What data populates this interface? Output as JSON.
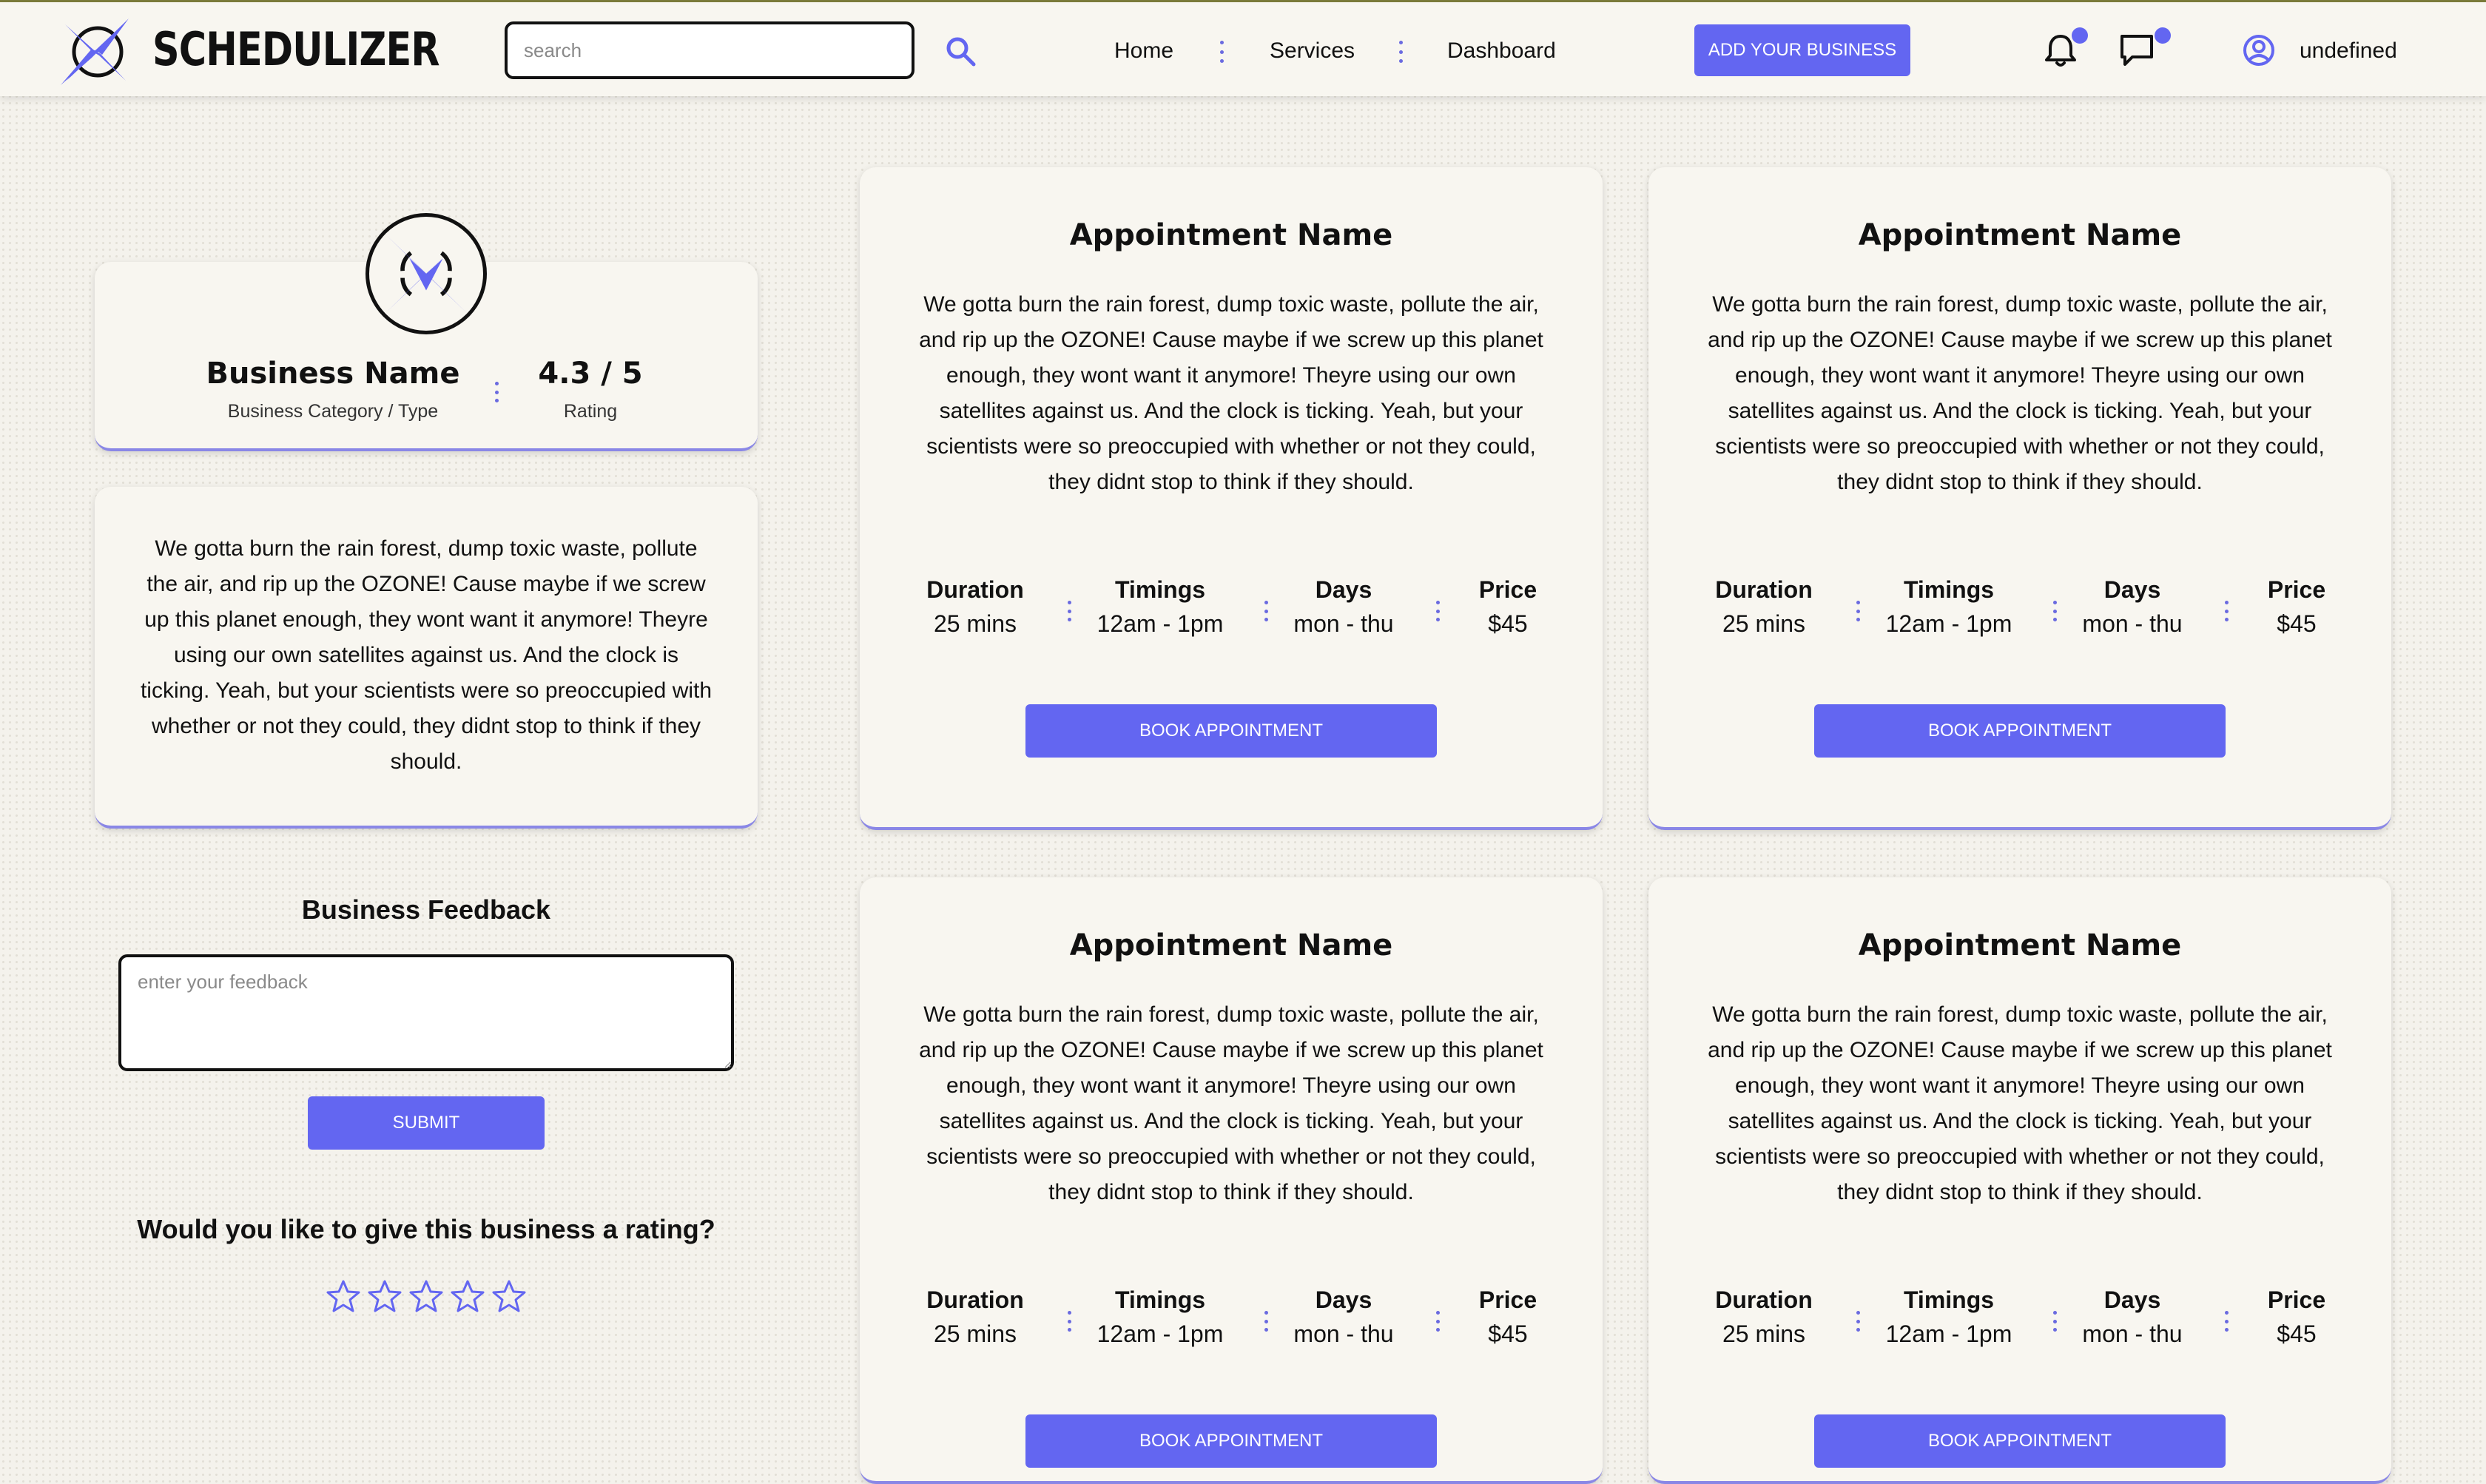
{
  "navbar": {
    "brand": "SCHEDULIZER",
    "search_placeholder": "search",
    "links": [
      "Home",
      "Services",
      "Dashboard"
    ],
    "add_business_label": "ADD YOUR BUSINESS",
    "username": "undefined",
    "notification_dot": true,
    "message_dot": true
  },
  "business": {
    "name": "Business Name",
    "category": "Business Category / Type",
    "rating": "4.3 / 5",
    "rating_label": "Rating",
    "description": "We gotta burn the rain forest, dump toxic waste, pollute the air, and rip up the OZONE! Cause maybe if we screw up this planet enough, they wont want it anymore! Theyre using our own satellites against us. And the clock is ticking. Yeah, but your scientists were so preoccupied with whether or not they could, they didnt stop to think if they should."
  },
  "feedback": {
    "title": "Business Feedback",
    "placeholder": "enter your feedback",
    "submit_label": "SUBMIT",
    "rating_question": "Would you like to give this business a rating?",
    "stars_selected": 0,
    "stars_total": 5
  },
  "appointments": [
    {
      "title": "Appointment Name",
      "description": "We gotta burn the rain forest, dump toxic waste, pollute the air, and rip up the OZONE! Cause maybe if we screw up this planet enough, they wont want it anymore! Theyre using our own satellites against us. And the clock is ticking. Yeah, but your scientists were so preoccupied with whether or not they could, they didnt stop to think if they should.",
      "duration_label": "Duration",
      "duration": "25 mins",
      "timings_label": "Timings",
      "timings": "12am - 1pm",
      "days_label": "Days",
      "days": "mon - thu",
      "price_label": "Price",
      "price": "$45",
      "book_label": "BOOK APPOINTMENT"
    },
    {
      "title": "Appointment Name",
      "description": "We gotta burn the rain forest, dump toxic waste, pollute the air, and rip up the OZONE! Cause maybe if we screw up this planet enough, they wont want it anymore! Theyre using our own satellites against us. And the clock is ticking. Yeah, but your scientists were so preoccupied with whether or not they could, they didnt stop to think if they should.",
      "duration_label": "Duration",
      "duration": "25 mins",
      "timings_label": "Timings",
      "timings": "12am - 1pm",
      "days_label": "Days",
      "days": "mon - thu",
      "price_label": "Price",
      "price": "$45",
      "book_label": "BOOK APPOINTMENT"
    },
    {
      "title": "Appointment Name",
      "description": "We gotta burn the rain forest, dump toxic waste, pollute the air, and rip up the OZONE! Cause maybe if we screw up this planet enough, they wont want it anymore! Theyre using our own satellites against us. And the clock is ticking. Yeah, but your scientists were so preoccupied with whether or not they could, they didnt stop to think if they should.",
      "duration_label": "Duration",
      "duration": "25 mins",
      "timings_label": "Timings",
      "timings": "12am - 1pm",
      "days_label": "Days",
      "days": "mon - thu",
      "price_label": "Price",
      "price": "$45",
      "book_label": "BOOK APPOINTMENT"
    },
    {
      "title": "Appointment Name",
      "description": "We gotta burn the rain forest, dump toxic waste, pollute the air, and rip up the OZONE! Cause maybe if we screw up this planet enough, they wont want it anymore! Theyre using our own satellites against us. And the clock is ticking. Yeah, but your scientists were so preoccupied with whether or not they could, they didnt stop to think if they should.",
      "duration_label": "Duration",
      "duration": "25 mins",
      "timings_label": "Timings",
      "timings": "12am - 1pm",
      "days_label": "Days",
      "days": "mon - thu",
      "price_label": "Price",
      "price": "$45",
      "book_label": "BOOK APPOINTMENT"
    }
  ],
  "colors": {
    "accent": "#6366f1",
    "page_background": "#f4f2ec",
    "card_background": "#f8f6f0"
  }
}
